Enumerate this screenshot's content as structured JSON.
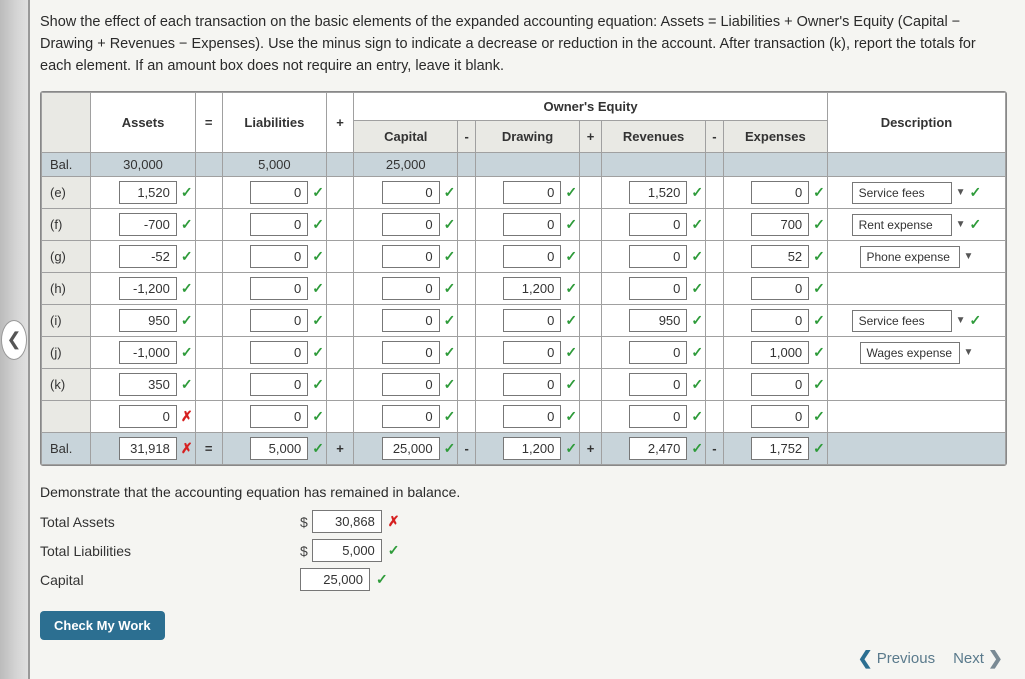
{
  "instructions": "Show the effect of each transaction on the basic elements of the expanded accounting equation: Assets = Liabilities + Owner's Equity (Capital − Drawing + Revenues − Expenses). Use the minus sign to indicate a decrease or reduction in the account. After transaction (k), report the totals for each element. If an amount box does not require an entry, leave it blank.",
  "owner_equity_label": "Owner's Equity",
  "headers": {
    "assets": "Assets",
    "eq": "=",
    "liab": "Liabilities",
    "plus": "+",
    "capital": "Capital",
    "minus": "-",
    "drawing": "Drawing",
    "plus2": "+",
    "revenues": "Revenues",
    "minus2": "-",
    "expenses": "Expenses",
    "desc": "Description"
  },
  "rows": [
    {
      "label": "Bal.",
      "style": "bal",
      "cells": [
        {
          "txt": "30,000",
          "plain": true
        },
        {
          "op": ""
        },
        {
          "txt": "5,000",
          "plain": true
        },
        {
          "op": ""
        },
        {
          "txt": "25,000",
          "plain": true
        },
        {
          "op": ""
        },
        {
          "txt": "",
          "plain": true
        },
        {
          "op": ""
        },
        {
          "txt": "",
          "plain": true
        },
        {
          "op": ""
        },
        {
          "txt": "",
          "plain": true
        }
      ],
      "desc": ""
    },
    {
      "label": "(e)",
      "cells": [
        {
          "txt": "1,520",
          "mark": "check"
        },
        {
          "op": ""
        },
        {
          "txt": "0",
          "mark": "check"
        },
        {
          "op": ""
        },
        {
          "txt": "0",
          "mark": "check"
        },
        {
          "op": ""
        },
        {
          "txt": "0",
          "mark": "check"
        },
        {
          "op": ""
        },
        {
          "txt": "1,520",
          "mark": "check"
        },
        {
          "op": ""
        },
        {
          "txt": "0",
          "mark": "check"
        }
      ],
      "desc": "Service fees",
      "descmark": "check"
    },
    {
      "label": "(f)",
      "cells": [
        {
          "txt": "-700",
          "mark": "check"
        },
        {
          "op": ""
        },
        {
          "txt": "0",
          "mark": "check"
        },
        {
          "op": ""
        },
        {
          "txt": "0",
          "mark": "check"
        },
        {
          "op": ""
        },
        {
          "txt": "0",
          "mark": "check"
        },
        {
          "op": ""
        },
        {
          "txt": "0",
          "mark": "check"
        },
        {
          "op": ""
        },
        {
          "txt": "700",
          "mark": "check"
        }
      ],
      "desc": "Rent expense",
      "descmark": "check"
    },
    {
      "label": "(g)",
      "cells": [
        {
          "txt": "-52",
          "mark": "check"
        },
        {
          "op": ""
        },
        {
          "txt": "0",
          "mark": "check"
        },
        {
          "op": ""
        },
        {
          "txt": "0",
          "mark": "check"
        },
        {
          "op": ""
        },
        {
          "txt": "0",
          "mark": "check"
        },
        {
          "op": ""
        },
        {
          "txt": "0",
          "mark": "check"
        },
        {
          "op": ""
        },
        {
          "txt": "52",
          "mark": "check"
        }
      ],
      "desc": "Phone expense",
      "descmark": ""
    },
    {
      "label": "(h)",
      "cells": [
        {
          "txt": "-1,200",
          "mark": "check"
        },
        {
          "op": ""
        },
        {
          "txt": "0",
          "mark": "check"
        },
        {
          "op": ""
        },
        {
          "txt": "0",
          "mark": "check"
        },
        {
          "op": ""
        },
        {
          "txt": "1,200",
          "mark": "check"
        },
        {
          "op": ""
        },
        {
          "txt": "0",
          "mark": "check"
        },
        {
          "op": ""
        },
        {
          "txt": "0",
          "mark": "check"
        }
      ],
      "desc": "",
      "descmark": ""
    },
    {
      "label": "(i)",
      "cells": [
        {
          "txt": "950",
          "mark": "check"
        },
        {
          "op": ""
        },
        {
          "txt": "0",
          "mark": "check"
        },
        {
          "op": ""
        },
        {
          "txt": "0",
          "mark": "check"
        },
        {
          "op": ""
        },
        {
          "txt": "0",
          "mark": "check"
        },
        {
          "op": ""
        },
        {
          "txt": "950",
          "mark": "check"
        },
        {
          "op": ""
        },
        {
          "txt": "0",
          "mark": "check"
        }
      ],
      "desc": "Service fees",
      "descmark": "check"
    },
    {
      "label": "(j)",
      "cells": [
        {
          "txt": "-1,000",
          "mark": "check"
        },
        {
          "op": ""
        },
        {
          "txt": "0",
          "mark": "check"
        },
        {
          "op": ""
        },
        {
          "txt": "0",
          "mark": "check"
        },
        {
          "op": ""
        },
        {
          "txt": "0",
          "mark": "check"
        },
        {
          "op": ""
        },
        {
          "txt": "0",
          "mark": "check"
        },
        {
          "op": ""
        },
        {
          "txt": "1,000",
          "mark": "check"
        }
      ],
      "desc": "Wages expense",
      "descmark": ""
    },
    {
      "label": "(k)",
      "cells": [
        {
          "txt": "350",
          "mark": "check"
        },
        {
          "op": ""
        },
        {
          "txt": "0",
          "mark": "check"
        },
        {
          "op": ""
        },
        {
          "txt": "0",
          "mark": "check"
        },
        {
          "op": ""
        },
        {
          "txt": "0",
          "mark": "check"
        },
        {
          "op": ""
        },
        {
          "txt": "0",
          "mark": "check"
        },
        {
          "op": ""
        },
        {
          "txt": "0",
          "mark": "check"
        }
      ],
      "desc": "",
      "descmark": ""
    },
    {
      "label": "",
      "cells": [
        {
          "txt": "0",
          "mark": "cross"
        },
        {
          "op": ""
        },
        {
          "txt": "0",
          "mark": "check"
        },
        {
          "op": ""
        },
        {
          "txt": "0",
          "mark": "check"
        },
        {
          "op": ""
        },
        {
          "txt": "0",
          "mark": "check"
        },
        {
          "op": ""
        },
        {
          "txt": "0",
          "mark": "check"
        },
        {
          "op": ""
        },
        {
          "txt": "0",
          "mark": "check"
        }
      ],
      "desc": "",
      "descmark": ""
    },
    {
      "label": "Bal.",
      "style": "bal",
      "cells": [
        {
          "txt": "31,918",
          "mark": "cross"
        },
        {
          "op": "="
        },
        {
          "txt": "5,000",
          "mark": "check"
        },
        {
          "op": "+"
        },
        {
          "txt": "25,000",
          "mark": "check"
        },
        {
          "op": "-"
        },
        {
          "txt": "1,200",
          "mark": "check"
        },
        {
          "op": "+"
        },
        {
          "txt": "2,470",
          "mark": "check"
        },
        {
          "op": "-"
        },
        {
          "txt": "1,752",
          "mark": "check"
        }
      ],
      "desc": ""
    }
  ],
  "section2_title": "Demonstrate that the accounting equation has remained in balance.",
  "balances": [
    {
      "label": "Total Assets",
      "dol": "$",
      "val": "30,868",
      "mark": "cross"
    },
    {
      "label": "Total Liabilities",
      "dol": "$",
      "val": "5,000",
      "mark": "check"
    },
    {
      "label": "Capital",
      "dol": "",
      "val": "25,000",
      "mark": "check"
    }
  ],
  "check_btn": "Check My Work",
  "previous": "Previous",
  "next": "Next"
}
